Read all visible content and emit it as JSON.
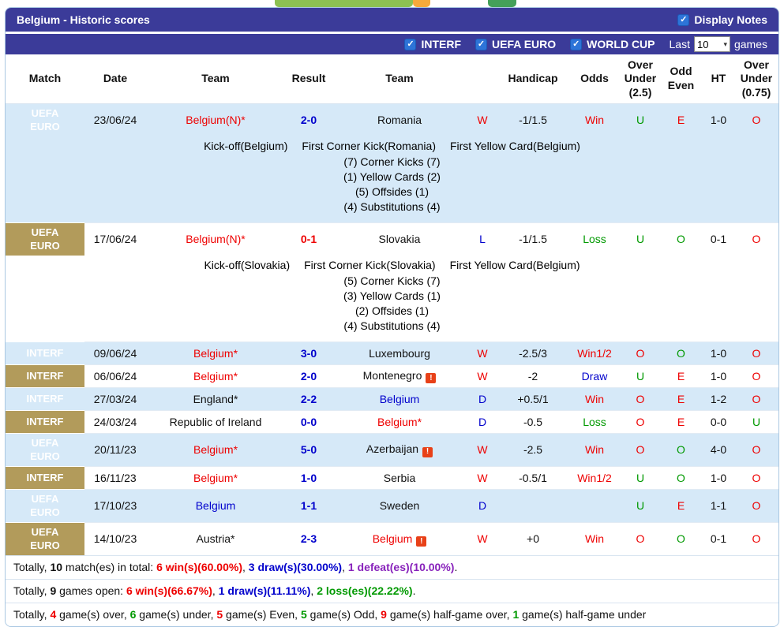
{
  "title_bar": {
    "title": "Belgium - Historic scores",
    "display_notes_label": "Display Notes",
    "display_notes_checked": true
  },
  "filter_bar": {
    "checkboxes": [
      {
        "label": "INTERF",
        "checked": true
      },
      {
        "label": "UEFA EURO",
        "checked": true
      },
      {
        "label": "WORLD CUP",
        "checked": true
      }
    ],
    "last_label": "Last",
    "games_count": "10",
    "games_label": "games"
  },
  "icons": {
    "checkbox_check": "✓",
    "select_caret": "▾",
    "red_card": "!"
  },
  "palette": {
    "header_purple": "#3b3b99",
    "badge_tan": "#b29b5b",
    "row_highlight": "#d6e9f8",
    "red": "#ee0000",
    "blue": "#0000cc",
    "green": "#009900",
    "purple": "#8822bb",
    "checkbox_blue": "#2d74d8"
  },
  "table": {
    "headers": [
      "Match",
      "Date",
      "Team",
      "Result",
      "Team",
      "",
      "Handicap",
      "Odds",
      "Over Under (2.5)",
      "Odd Even",
      "HT",
      "Over Under (0.75)"
    ],
    "rows": [
      {
        "competition": "UEFA\nEURO",
        "date": "23/06/24",
        "home": {
          "name": "Belgium(N)*",
          "color": "red"
        },
        "result": {
          "text": "2-0",
          "color": "blue"
        },
        "away": {
          "name": "Romania",
          "color": "black"
        },
        "outcome": {
          "text": "W",
          "color": "red"
        },
        "handicap": "-1/1.5",
        "odds": {
          "text": "Win",
          "color": "red"
        },
        "ou25": {
          "text": "U",
          "color": "green"
        },
        "oddEven": {
          "text": "E",
          "color": "red"
        },
        "ht": "1-0",
        "ou075": {
          "text": "O",
          "color": "red"
        },
        "highlight": true,
        "notes": {
          "header": [
            "Kick-off(Belgium)",
            "First Corner Kick(Romania)",
            "First Yellow Card(Belgium)"
          ],
          "lines": [
            "(7) Corner Kicks (7)",
            "(1) Yellow Cards (2)",
            "(5) Offsides (1)",
            "(4) Substitutions (4)"
          ]
        }
      },
      {
        "competition": "UEFA\nEURO",
        "date": "17/06/24",
        "home": {
          "name": "Belgium(N)*",
          "color": "red"
        },
        "result": {
          "text": "0-1",
          "color": "red"
        },
        "away": {
          "name": "Slovakia",
          "color": "black"
        },
        "outcome": {
          "text": "L",
          "color": "blue"
        },
        "handicap": "-1/1.5",
        "odds": {
          "text": "Loss",
          "color": "green"
        },
        "ou25": {
          "text": "U",
          "color": "green"
        },
        "oddEven": {
          "text": "O",
          "color": "green"
        },
        "ht": "0-1",
        "ou075": {
          "text": "O",
          "color": "red"
        },
        "highlight": false,
        "notes": {
          "header": [
            "Kick-off(Slovakia)",
            "First Corner Kick(Slovakia)",
            "First Yellow Card(Belgium)"
          ],
          "lines": [
            "(5) Corner Kicks (7)",
            "(3) Yellow Cards (1)",
            "(2) Offsides (1)",
            "(4) Substitutions (4)"
          ]
        }
      },
      {
        "competition": "INTERF",
        "date": "09/06/24",
        "home": {
          "name": "Belgium*",
          "color": "red"
        },
        "result": {
          "text": "3-0",
          "color": "blue"
        },
        "away": {
          "name": "Luxembourg",
          "color": "black"
        },
        "outcome": {
          "text": "W",
          "color": "red"
        },
        "handicap": "-2.5/3",
        "odds": {
          "text": "Win1/2",
          "color": "red"
        },
        "ou25": {
          "text": "O",
          "color": "red"
        },
        "oddEven": {
          "text": "O",
          "color": "green"
        },
        "ht": "1-0",
        "ou075": {
          "text": "O",
          "color": "red"
        },
        "highlight": true
      },
      {
        "competition": "INTERF",
        "date": "06/06/24",
        "home": {
          "name": "Belgium*",
          "color": "red"
        },
        "result": {
          "text": "2-0",
          "color": "blue"
        },
        "away": {
          "name": "Montenegro",
          "color": "black",
          "icon": true
        },
        "outcome": {
          "text": "W",
          "color": "red"
        },
        "handicap": "-2",
        "odds": {
          "text": "Draw",
          "color": "blue"
        },
        "ou25": {
          "text": "U",
          "color": "green"
        },
        "oddEven": {
          "text": "E",
          "color": "red"
        },
        "ht": "1-0",
        "ou075": {
          "text": "O",
          "color": "red"
        },
        "highlight": false
      },
      {
        "competition": "INTERF",
        "date": "27/03/24",
        "home": {
          "name": "England*",
          "color": "black"
        },
        "result": {
          "text": "2-2",
          "color": "blue"
        },
        "away": {
          "name": "Belgium",
          "color": "blue"
        },
        "outcome": {
          "text": "D",
          "color": "blue"
        },
        "handicap": "+0.5/1",
        "odds": {
          "text": "Win",
          "color": "red"
        },
        "ou25": {
          "text": "O",
          "color": "red"
        },
        "oddEven": {
          "text": "E",
          "color": "red"
        },
        "ht": "1-2",
        "ou075": {
          "text": "O",
          "color": "red"
        },
        "highlight": true
      },
      {
        "competition": "INTERF",
        "date": "24/03/24",
        "home": {
          "name": "Republic of Ireland",
          "color": "black"
        },
        "result": {
          "text": "0-0",
          "color": "blue"
        },
        "away": {
          "name": "Belgium*",
          "color": "red"
        },
        "outcome": {
          "text": "D",
          "color": "blue"
        },
        "handicap": "-0.5",
        "odds": {
          "text": "Loss",
          "color": "green"
        },
        "ou25": {
          "text": "O",
          "color": "red"
        },
        "oddEven": {
          "text": "E",
          "color": "red"
        },
        "ht": "0-0",
        "ou075": {
          "text": "U",
          "color": "green"
        },
        "highlight": false
      },
      {
        "competition": "UEFA\nEURO",
        "date": "20/11/23",
        "home": {
          "name": "Belgium*",
          "color": "red"
        },
        "result": {
          "text": "5-0",
          "color": "blue"
        },
        "away": {
          "name": "Azerbaijan",
          "color": "black",
          "icon": true
        },
        "outcome": {
          "text": "W",
          "color": "red"
        },
        "handicap": "-2.5",
        "odds": {
          "text": "Win",
          "color": "red"
        },
        "ou25": {
          "text": "O",
          "color": "red"
        },
        "oddEven": {
          "text": "O",
          "color": "green"
        },
        "ht": "4-0",
        "ou075": {
          "text": "O",
          "color": "red"
        },
        "highlight": true
      },
      {
        "competition": "INTERF",
        "date": "16/11/23",
        "home": {
          "name": "Belgium*",
          "color": "red"
        },
        "result": {
          "text": "1-0",
          "color": "blue"
        },
        "away": {
          "name": "Serbia",
          "color": "black"
        },
        "outcome": {
          "text": "W",
          "color": "red"
        },
        "handicap": "-0.5/1",
        "odds": {
          "text": "Win1/2",
          "color": "red"
        },
        "ou25": {
          "text": "U",
          "color": "green"
        },
        "oddEven": {
          "text": "O",
          "color": "green"
        },
        "ht": "1-0",
        "ou075": {
          "text": "O",
          "color": "red"
        },
        "highlight": false
      },
      {
        "competition": "UEFA\nEURO",
        "date": "17/10/23",
        "home": {
          "name": "Belgium",
          "color": "blue"
        },
        "result": {
          "text": "1-1",
          "color": "blue"
        },
        "away": {
          "name": "Sweden",
          "color": "black"
        },
        "outcome": {
          "text": "D",
          "color": "blue"
        },
        "handicap": "",
        "odds": {
          "text": "",
          "color": "black"
        },
        "ou25": {
          "text": "U",
          "color": "green"
        },
        "oddEven": {
          "text": "E",
          "color": "red"
        },
        "ht": "1-1",
        "ou075": {
          "text": "O",
          "color": "red"
        },
        "highlight": true
      },
      {
        "competition": "UEFA\nEURO",
        "date": "14/10/23",
        "home": {
          "name": "Austria*",
          "color": "black"
        },
        "result": {
          "text": "2-3",
          "color": "blue"
        },
        "away": {
          "name": "Belgium",
          "color": "red",
          "icon": true
        },
        "outcome": {
          "text": "W",
          "color": "red"
        },
        "handicap": "+0",
        "odds": {
          "text": "Win",
          "color": "red"
        },
        "ou25": {
          "text": "O",
          "color": "red"
        },
        "oddEven": {
          "text": "O",
          "color": "green"
        },
        "ht": "0-1",
        "ou075": {
          "text": "O",
          "color": "red"
        },
        "highlight": false
      }
    ]
  },
  "summary_lines": [
    [
      {
        "text": "Totally, ",
        "color": "black"
      },
      {
        "text": "10",
        "color": "black",
        "bold": true
      },
      {
        "text": " match(es) in total: ",
        "color": "black"
      },
      {
        "text": "6 win(s)(60.00%)",
        "color": "red",
        "bold": true
      },
      {
        "text": ", ",
        "color": "black"
      },
      {
        "text": "3 draw(s)(30.00%)",
        "color": "blue",
        "bold": true
      },
      {
        "text": ", ",
        "color": "black"
      },
      {
        "text": "1 defeat(es)(10.00%)",
        "color": "purple",
        "bold": true
      },
      {
        "text": ".",
        "color": "black"
      }
    ],
    [
      {
        "text": "Totally, ",
        "color": "black"
      },
      {
        "text": "9",
        "color": "black",
        "bold": true
      },
      {
        "text": " games open: ",
        "color": "black"
      },
      {
        "text": "6 win(s)(66.67%)",
        "color": "red",
        "bold": true
      },
      {
        "text": ", ",
        "color": "black"
      },
      {
        "text": "1 draw(s)(11.11%)",
        "color": "blue",
        "bold": true
      },
      {
        "text": ", ",
        "color": "black"
      },
      {
        "text": "2 loss(es)(22.22%)",
        "color": "green",
        "bold": true
      },
      {
        "text": ".",
        "color": "black"
      }
    ],
    [
      {
        "text": "Totally, ",
        "color": "black"
      },
      {
        "text": "4",
        "color": "red",
        "bold": true
      },
      {
        "text": " game(s) over, ",
        "color": "black"
      },
      {
        "text": "6",
        "color": "green",
        "bold": true
      },
      {
        "text": " game(s) under, ",
        "color": "black"
      },
      {
        "text": "5",
        "color": "red",
        "bold": true
      },
      {
        "text": " game(s) Even, ",
        "color": "black"
      },
      {
        "text": "5",
        "color": "green",
        "bold": true
      },
      {
        "text": " game(s) Odd, ",
        "color": "black"
      },
      {
        "text": "9",
        "color": "red",
        "bold": true
      },
      {
        "text": " game(s) half-game over, ",
        "color": "black"
      },
      {
        "text": "1",
        "color": "green",
        "bold": true
      },
      {
        "text": " game(s) half-game under",
        "color": "black"
      }
    ]
  ]
}
